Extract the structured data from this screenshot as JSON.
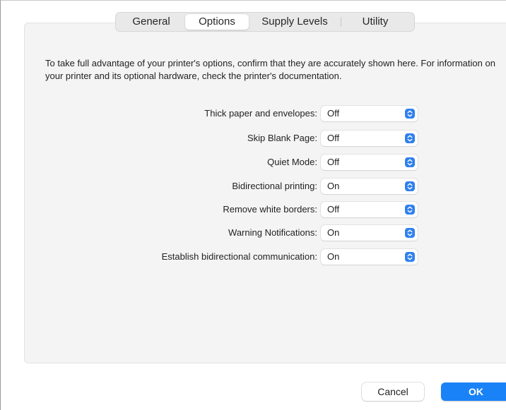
{
  "tabs": [
    {
      "label": "General",
      "active": false
    },
    {
      "label": "Options",
      "active": true
    },
    {
      "label": "Supply Levels",
      "active": false
    },
    {
      "label": "Utility",
      "active": false
    }
  ],
  "description": "To take full advantage of your printer's options, confirm that they are accurately shown here. For information on your printer and its optional hardware, check the printer's documentation.",
  "options": [
    {
      "label": "Thick paper and envelopes:",
      "value": "Off"
    },
    {
      "label": "Skip Blank Page:",
      "value": "Off"
    },
    {
      "label": "Quiet Mode:",
      "value": "Off"
    },
    {
      "label": "Bidirectional printing:",
      "value": "On"
    },
    {
      "label": "Remove white borders:",
      "value": "Off"
    },
    {
      "label": "Warning Notifications:",
      "value": "On"
    },
    {
      "label": "Establish bidirectional communication:",
      "value": "On"
    }
  ],
  "buttons": {
    "cancel": "Cancel",
    "ok": "OK"
  },
  "colors": {
    "accent": "#1a82f7",
    "stepper": "#2f80ed",
    "panel": "#f4f4f4"
  },
  "icons": {
    "stepper": "chevron-up-down-icon"
  }
}
